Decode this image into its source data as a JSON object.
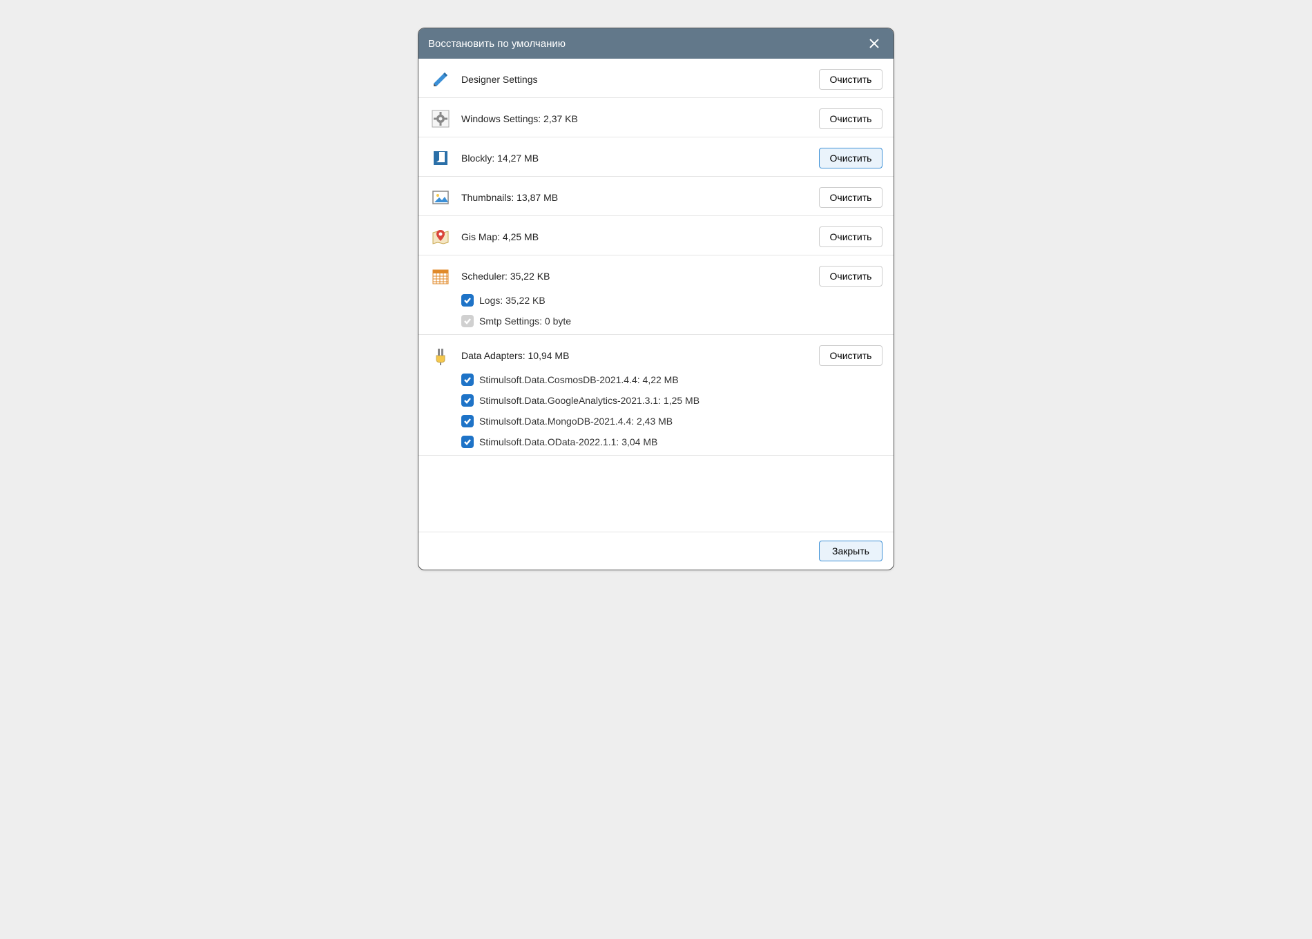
{
  "dialog": {
    "title": "Восстановить по умолчанию"
  },
  "buttons": {
    "clear": "Очистить",
    "close": "Закрыть"
  },
  "sections": {
    "designer": {
      "label": "Designer Settings"
    },
    "windows": {
      "label": "Windows Settings: 2,37 KB"
    },
    "blockly": {
      "label": "Blockly: 14,27 MB"
    },
    "thumbnails": {
      "label": "Thumbnails: 13,87 MB"
    },
    "gismap": {
      "label": "Gis Map: 4,25 MB"
    },
    "scheduler": {
      "label": "Scheduler: 35,22 KB",
      "subitems": {
        "logs": {
          "label": "Logs: 35,22 KB",
          "checked": true,
          "disabled": false
        },
        "smtp": {
          "label": "Smtp Settings: 0 byte",
          "checked": true,
          "disabled": true
        }
      }
    },
    "adapters": {
      "label": "Data Adapters: 10,94 MB",
      "subitems": {
        "cosmos": {
          "label": "Stimulsoft.Data.CosmosDB-2021.4.4: 4,22 MB"
        },
        "ga": {
          "label": "Stimulsoft.Data.GoogleAnalytics-2021.3.1: 1,25 MB"
        },
        "mongo": {
          "label": "Stimulsoft.Data.MongoDB-2021.4.4: 2,43 MB"
        },
        "odata": {
          "label": "Stimulsoft.Data.OData-2022.1.1: 3,04 MB"
        }
      }
    }
  }
}
